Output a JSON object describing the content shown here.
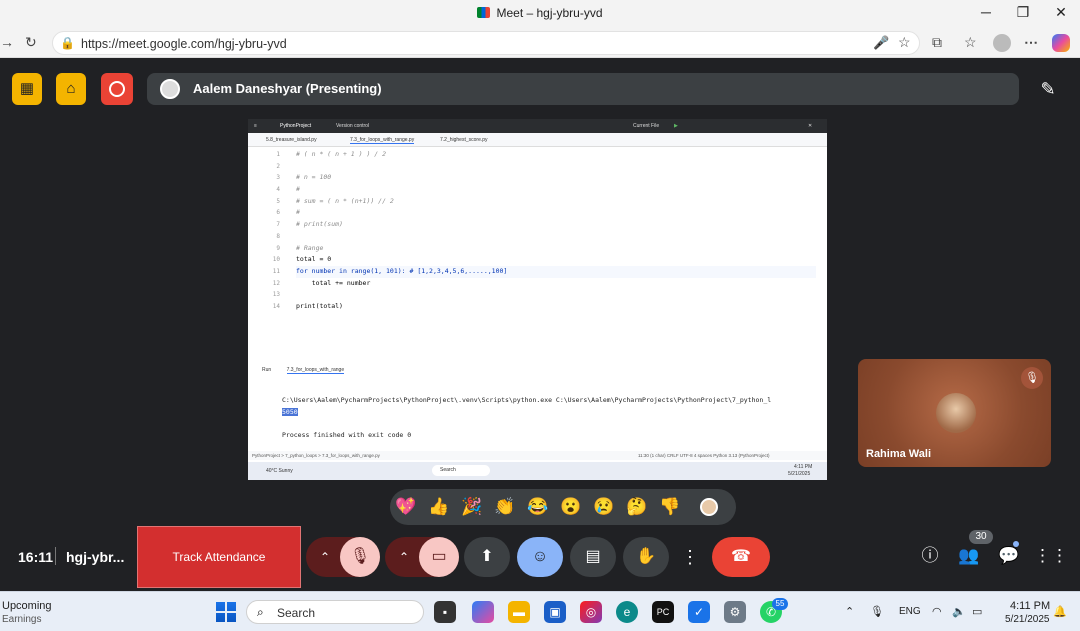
{
  "browser": {
    "tab_title": "Meet – hgj-ybru-yvd",
    "url": "https://meet.google.com/hgj-ybru-yvd",
    "window_controls": [
      "minimize-icon",
      "maximize-icon",
      "close-icon"
    ]
  },
  "meet": {
    "presenter_label": "Aalem Daneshyar (Presenting)",
    "self_name": "Rahima Wali",
    "clock": "16:11",
    "meeting_code": "hgj-ybr...",
    "track_attendance": "Track Attendance",
    "people_count": "30",
    "reactions": [
      "💖",
      "👍",
      "🎉",
      "👏",
      "😂",
      "😮",
      "😢",
      "🤔",
      "👎"
    ],
    "accent_colors": {
      "end_call": "#ea4335",
      "active_control": "#8ab4f8",
      "track_button": "#d32f2f"
    }
  },
  "shared_screen": {
    "ide_header": {
      "project": "PythonProject",
      "vcs": "Version control",
      "run_config": "Current File"
    },
    "tabs": [
      "5.8_treasure_island.py",
      "7.3_for_loops_with_range.py",
      "7.2_highest_score.py"
    ],
    "line_numbers": [
      "1",
      "2",
      "3",
      "4",
      "5",
      "6",
      "7",
      "8",
      "9",
      "10",
      "11",
      "12",
      "13",
      "14"
    ],
    "code": [
      "# ( n * ( n + 1 ) ) / 2",
      "",
      "# n = 100",
      "#",
      "# sum = ( n * (n+1)) // 2",
      "#",
      "# print(sum)",
      "",
      "# Range",
      "total = 0",
      "for number in range(1, 101): # [1,2,3,4,5,6,.....,100]",
      "    total += number",
      "",
      "print(total)"
    ],
    "run_label": "Run",
    "run_tab": "7.3_for_loops_with_range",
    "output": [
      "C:\\Users\\Aalem\\PycharmProjects\\PythonProject\\.venv\\Scripts\\python.exe C:\\Users\\Aalem\\PycharmProjects\\PythonProject\\7_python_l",
      "5050",
      "",
      "Process finished with exit code 0"
    ],
    "status_path": "PythonProject  >  7_python_loops  >  7.3_for_loops_with_range.py",
    "status_right": "11:30 (1 char)   CRLF   UTF-8   4 spaces   Python 3.13 (PythonProject)",
    "inner_taskbar": {
      "weather": "40°C Sunny",
      "search": "Search",
      "time": "4:11 PM",
      "date": "5/21/2025"
    }
  },
  "taskbar": {
    "widget_title": "Upcoming",
    "widget_sub": "Earnings",
    "search_placeholder": "Search",
    "whatsapp_badge": "55",
    "lang": "ENG",
    "time": "4:11 PM",
    "date": "5/21/2025"
  }
}
